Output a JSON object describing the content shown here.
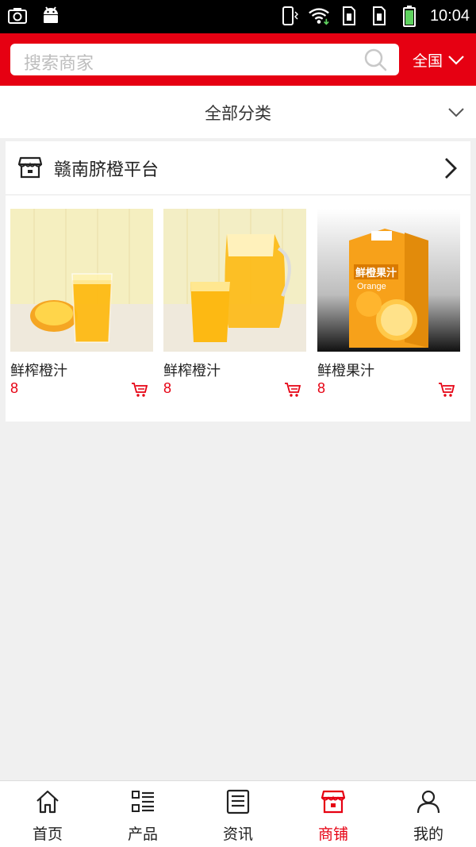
{
  "status_bar": {
    "time": "10:04",
    "icons": [
      "screenshot-icon",
      "android-icon",
      "vibrate-icon",
      "wifi-icon",
      "sim1-icon",
      "sim2-icon",
      "battery-icon"
    ]
  },
  "header": {
    "search_placeholder": "搜索商家",
    "region": "全国"
  },
  "category": {
    "label": "全部分类"
  },
  "shop": {
    "name": "赣南脐橙平台",
    "products": [
      {
        "name": "鲜榨橙汁",
        "price": "8"
      },
      {
        "name": "鲜榨橙汁",
        "price": "8"
      },
      {
        "name": "鲜橙果汁",
        "price": "8"
      }
    ],
    "package_text": "鲜橙果汁",
    "package_sub": "Orange"
  },
  "bottom_nav": {
    "items": [
      {
        "label": "首页",
        "icon": "home-icon"
      },
      {
        "label": "产品",
        "icon": "list-icon"
      },
      {
        "label": "资讯",
        "icon": "news-icon"
      },
      {
        "label": "商铺",
        "icon": "shop-icon",
        "active": true
      },
      {
        "label": "我的",
        "icon": "user-icon"
      }
    ]
  },
  "colors": {
    "brand_red": "#e60012",
    "background": "#f0f0f0",
    "text": "#222222"
  }
}
